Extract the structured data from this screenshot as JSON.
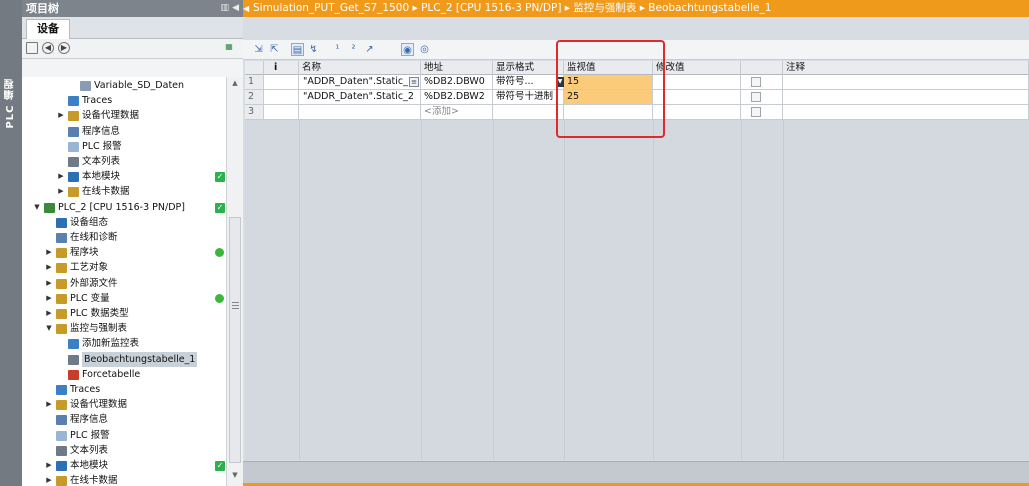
{
  "left_vertical_tab": "PLC 编程",
  "project_tree": {
    "title": "项目树",
    "header_buttons": "▥ ◀",
    "device_tab": "设备",
    "items": [
      {
        "label": "Variable_SD_Daten",
        "arrow": "",
        "icon": "db-icon",
        "color": "#8a9bb5"
      },
      {
        "label": "Traces",
        "arrow": "",
        "icon": "trace-icon",
        "color": "#3d7fc7"
      },
      {
        "label": "设备代理数据",
        "arrow": "▶",
        "icon": "folder-icon",
        "color": "#c89a2a"
      },
      {
        "label": "程序信息",
        "arrow": "",
        "icon": "info-icon",
        "color": "#5b7fb0"
      },
      {
        "label": "PLC 报警",
        "arrow": "",
        "icon": "alarm-icon",
        "color": "#9ab4d6"
      },
      {
        "label": "文本列表",
        "arrow": "",
        "icon": "list-icon",
        "color": "#6e7a88"
      },
      {
        "label": "本地模块",
        "arrow": "▶",
        "icon": "module-icon",
        "color": "#2b6fb5",
        "status": "check"
      },
      {
        "label": "在线卡数据",
        "arrow": "▶",
        "icon": "card-icon",
        "color": "#c89a2a"
      },
      {
        "label": "PLC_2 [CPU 1516-3 PN/DP]",
        "arrow": "▼",
        "icon": "cpu-icon",
        "color": "#3a8a3a",
        "status": "check"
      },
      {
        "label": "设备组态",
        "arrow": "",
        "icon": "config-icon",
        "color": "#2b6fb5"
      },
      {
        "label": "在线和诊断",
        "arrow": "",
        "icon": "diag-icon",
        "color": "#5b7fb0"
      },
      {
        "label": "程序块",
        "arrow": "▶",
        "icon": "folder-icon",
        "color": "#c89a2a",
        "status": "dot"
      },
      {
        "label": "工艺对象",
        "arrow": "▶",
        "icon": "folder-icon",
        "color": "#c89a2a"
      },
      {
        "label": "外部源文件",
        "arrow": "▶",
        "icon": "folder-icon",
        "color": "#c89a2a"
      },
      {
        "label": "PLC 变量",
        "arrow": "▶",
        "icon": "tag-icon",
        "color": "#c89a2a",
        "status": "dot"
      },
      {
        "label": "PLC 数据类型",
        "arrow": "▶",
        "icon": "type-icon",
        "color": "#c89a2a"
      },
      {
        "label": "监控与强制表",
        "arrow": "▼",
        "icon": "watch-folder-icon",
        "color": "#c89a2a"
      },
      {
        "label": "添加新监控表",
        "arrow": "",
        "icon": "add-table-icon",
        "color": "#3d7fc7"
      },
      {
        "label": "Beobachtungstabelle_1",
        "arrow": "",
        "icon": "watch-table-icon",
        "color": "#6e7a88",
        "selected": true
      },
      {
        "label": "Forcetabelle",
        "arrow": "",
        "icon": "force-table-icon",
        "color": "#c83c2a"
      },
      {
        "label": "Traces",
        "arrow": "",
        "icon": "trace-icon",
        "color": "#3d7fc7"
      },
      {
        "label": "设备代理数据",
        "arrow": "▶",
        "icon": "folder-icon",
        "color": "#c89a2a"
      },
      {
        "label": "程序信息",
        "arrow": "",
        "icon": "info-icon",
        "color": "#5b7fb0"
      },
      {
        "label": "PLC 报警",
        "arrow": "",
        "icon": "alarm-icon",
        "color": "#9ab4d6"
      },
      {
        "label": "文本列表",
        "arrow": "",
        "icon": "list-icon",
        "color": "#6e7a88"
      },
      {
        "label": "本地模块",
        "arrow": "▶",
        "icon": "module-icon",
        "color": "#2b6fb5",
        "status": "check"
      },
      {
        "label": "在线卡数据",
        "arrow": "▶",
        "icon": "card-icon",
        "color": "#c89a2a"
      }
    ]
  },
  "breadcrumb": {
    "arrow": "◀",
    "text": "Simulation_PUT_Get_S7_1500 ▸ PLC_2 [CPU 1516-3 PN/DP] ▸ 监控与强制表 ▸ Beobachtungstabelle_1"
  },
  "watch_table": {
    "columns": [
      "",
      "i",
      "名称",
      "地址",
      "显示格式",
      "监视值",
      "修改值",
      "",
      "注释"
    ],
    "rows": [
      {
        "num": "1",
        "name": "\"ADDR_Daten\".Static_1",
        "address": "%DB2.DBW0",
        "format": "带符号...",
        "monitor": "15"
      },
      {
        "num": "2",
        "name": "\"ADDR_Daten\".Static_2",
        "address": "%DB2.DBW2",
        "format": "带符号十进制",
        "monitor": "25"
      },
      {
        "num": "3",
        "name": "",
        "address": "<添加>",
        "format": "",
        "monitor": ""
      }
    ]
  },
  "colors": {
    "accent": "#f09a1c",
    "monitor_highlight": "#fbcb7a",
    "status_green": "#2bb24c",
    "annotation_box": "#e02a2a"
  }
}
